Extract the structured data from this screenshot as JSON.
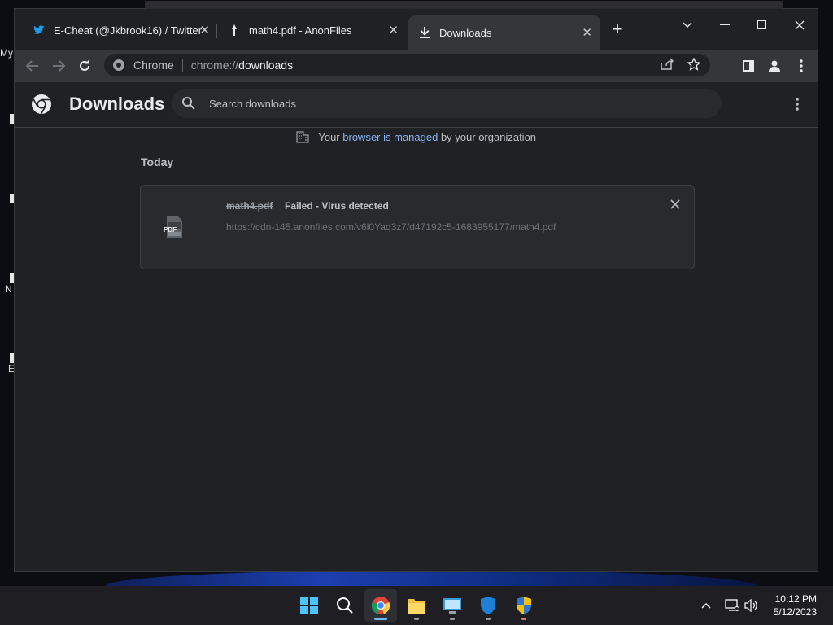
{
  "tabs": [
    {
      "title": "E-Cheat (@Jkbrook16) / Twitter",
      "icon": "twitter-icon"
    },
    {
      "title": "math4.pdf - AnonFiles",
      "icon": "anonfiles-icon"
    },
    {
      "title": "Downloads",
      "icon": "download-icon"
    }
  ],
  "omnibox": {
    "site_label": "Chrome",
    "scheme": "chrome://",
    "path": "downloads"
  },
  "page": {
    "title": "Downloads",
    "search_placeholder": "Search downloads",
    "managed_prefix": "Your",
    "managed_link": "browser is managed",
    "managed_suffix": "by your organization",
    "section_date": "Today"
  },
  "download": {
    "file_type_label": "PDF",
    "filename": "math4.pdf",
    "status": "Failed - Virus detected",
    "url": "https://cdn-145.anonfiles.com/v6l0Yaq3z7/d47192c5-1683955177/math4.pdf"
  },
  "desktop_icons": [
    "My",
    "N",
    "E"
  ],
  "clock": {
    "time": "10:12 PM",
    "date": "5/12/2023"
  },
  "colors": {
    "accent_link": "#8ab4f8",
    "window_bg": "#202124",
    "toolbar_bg": "#35363a"
  }
}
